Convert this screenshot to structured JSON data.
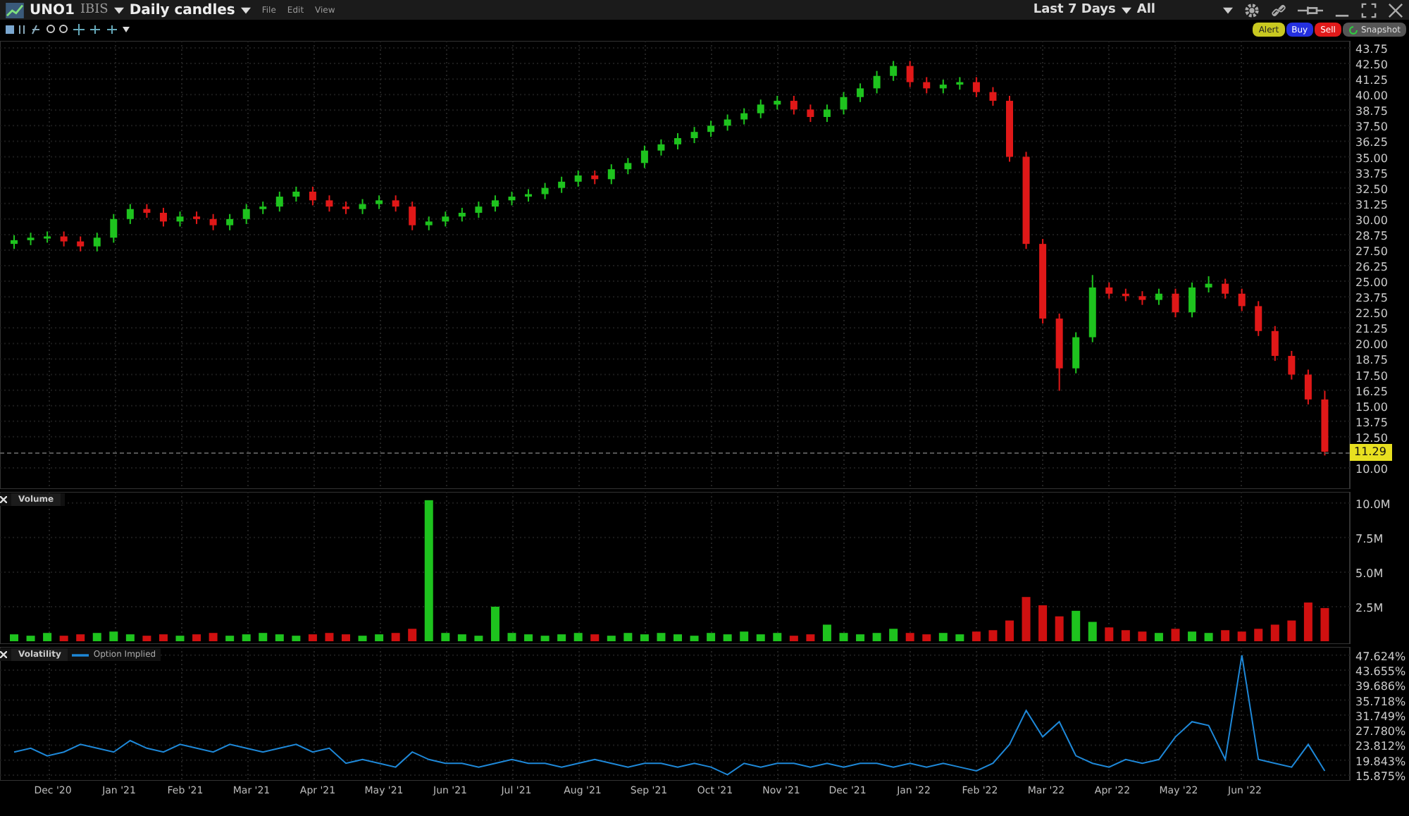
{
  "header": {
    "symbol": "UNO1",
    "exchange": "IBIS",
    "chart_type": "Daily candles",
    "menus": [
      "File",
      "Edit",
      "View"
    ],
    "period": "Last 7 Days",
    "range": "All"
  },
  "order_buttons": [
    {
      "label": "Alert",
      "kind": "alert"
    },
    {
      "label": "Buy",
      "kind": "buy"
    },
    {
      "label": "Sell",
      "kind": "sell"
    },
    {
      "label": "Snapshot",
      "kind": "snapshot"
    }
  ],
  "price_panel": {
    "last_price": "11.29",
    "chart_data": {
      "type": "candlestick",
      "grid": true,
      "categories": [
        null,
        null,
        null,
        null,
        null,
        null,
        null,
        null,
        null,
        null,
        null,
        null,
        null,
        null,
        null,
        null,
        null,
        null,
        null,
        null,
        null,
        null,
        null,
        null,
        null,
        null,
        null,
        null,
        null,
        null,
        null,
        null,
        null,
        null,
        null,
        null,
        null,
        null,
        null,
        null,
        null,
        null,
        null,
        null,
        null,
        null,
        null,
        null,
        null,
        null,
        null,
        null,
        null,
        null,
        null,
        null,
        null,
        null,
        null,
        null,
        null,
        null,
        null,
        null,
        null,
        null,
        null,
        null,
        null,
        null,
        null,
        null,
        null,
        null,
        null,
        null,
        null,
        null,
        null,
        null
      ],
      "ohlc": [
        [
          28.0,
          28.7,
          27.6,
          28.3
        ],
        [
          28.3,
          28.9,
          27.9,
          28.5
        ],
        [
          28.5,
          29.0,
          28.1,
          28.6
        ],
        [
          28.6,
          29.0,
          27.8,
          28.2
        ],
        [
          28.2,
          28.6,
          27.4,
          27.8
        ],
        [
          27.8,
          28.9,
          27.4,
          28.5
        ],
        [
          28.5,
          30.4,
          28.1,
          30.0
        ],
        [
          30.0,
          31.2,
          29.6,
          30.8
        ],
        [
          30.8,
          31.2,
          30.1,
          30.5
        ],
        [
          30.5,
          30.9,
          29.4,
          29.8
        ],
        [
          29.8,
          30.6,
          29.4,
          30.2
        ],
        [
          30.2,
          30.6,
          29.6,
          30.0
        ],
        [
          30.0,
          30.4,
          29.1,
          29.5
        ],
        [
          29.5,
          30.4,
          29.1,
          30.0
        ],
        [
          30.0,
          31.2,
          29.6,
          30.8
        ],
        [
          30.8,
          31.4,
          30.4,
          31.0
        ],
        [
          31.0,
          32.2,
          30.6,
          31.8
        ],
        [
          31.8,
          32.6,
          31.4,
          32.2
        ],
        [
          32.2,
          32.6,
          31.1,
          31.5
        ],
        [
          31.5,
          31.9,
          30.6,
          31.0
        ],
        [
          31.0,
          31.4,
          30.4,
          30.8
        ],
        [
          30.8,
          31.6,
          30.4,
          31.2
        ],
        [
          31.2,
          31.9,
          30.8,
          31.5
        ],
        [
          31.5,
          31.9,
          30.6,
          31.0
        ],
        [
          31.0,
          31.4,
          29.1,
          29.5
        ],
        [
          29.5,
          30.2,
          29.1,
          29.8
        ],
        [
          29.8,
          30.6,
          29.4,
          30.2
        ],
        [
          30.2,
          30.9,
          29.8,
          30.5
        ],
        [
          30.5,
          31.4,
          30.1,
          31.0
        ],
        [
          31.0,
          31.9,
          30.6,
          31.5
        ],
        [
          31.5,
          32.2,
          31.1,
          31.8
        ],
        [
          31.8,
          32.4,
          31.4,
          32.0
        ],
        [
          32.0,
          32.9,
          31.6,
          32.5
        ],
        [
          32.5,
          33.4,
          32.1,
          33.0
        ],
        [
          33.0,
          33.9,
          32.6,
          33.5
        ],
        [
          33.5,
          33.9,
          32.8,
          33.2
        ],
        [
          33.2,
          34.4,
          32.8,
          34.0
        ],
        [
          34.0,
          34.9,
          33.6,
          34.5
        ],
        [
          34.5,
          35.9,
          34.1,
          35.5
        ],
        [
          35.5,
          36.4,
          35.1,
          36.0
        ],
        [
          36.0,
          36.9,
          35.6,
          36.5
        ],
        [
          36.5,
          37.4,
          36.1,
          37.0
        ],
        [
          37.0,
          37.9,
          36.6,
          37.5
        ],
        [
          37.5,
          38.4,
          37.1,
          38.0
        ],
        [
          38.0,
          38.9,
          37.6,
          38.5
        ],
        [
          38.5,
          39.6,
          38.1,
          39.2
        ],
        [
          39.2,
          39.9,
          38.8,
          39.5
        ],
        [
          39.5,
          39.9,
          38.4,
          38.8
        ],
        [
          38.8,
          39.2,
          37.8,
          38.2
        ],
        [
          38.2,
          39.2,
          37.8,
          38.8
        ],
        [
          38.8,
          40.2,
          38.4,
          39.8
        ],
        [
          39.8,
          40.9,
          39.4,
          40.5
        ],
        [
          40.5,
          41.9,
          40.1,
          41.5
        ],
        [
          41.5,
          42.7,
          41.1,
          42.3
        ],
        [
          42.3,
          42.7,
          40.6,
          41.0
        ],
        [
          41.0,
          41.4,
          40.1,
          40.5
        ],
        [
          40.5,
          41.2,
          40.1,
          40.8
        ],
        [
          40.8,
          41.4,
          40.4,
          41.0
        ],
        [
          41.0,
          41.4,
          39.8,
          40.2
        ],
        [
          40.2,
          40.6,
          39.1,
          39.5
        ],
        [
          39.5,
          39.9,
          34.6,
          35.0
        ],
        [
          35.0,
          35.4,
          27.6,
          28.0
        ],
        [
          28.0,
          28.4,
          21.6,
          22.0
        ],
        [
          22.0,
          22.4,
          16.2,
          18.0
        ],
        [
          18.0,
          20.9,
          17.6,
          20.5
        ],
        [
          20.5,
          25.5,
          20.1,
          24.5
        ],
        [
          24.5,
          24.9,
          23.6,
          24.0
        ],
        [
          24.0,
          24.4,
          23.4,
          23.8
        ],
        [
          23.8,
          24.2,
          23.1,
          23.5
        ],
        [
          23.5,
          24.4,
          23.1,
          24.0
        ],
        [
          24.0,
          24.4,
          22.1,
          22.5
        ],
        [
          22.5,
          24.9,
          22.1,
          24.5
        ],
        [
          24.5,
          25.4,
          24.1,
          24.8
        ],
        [
          24.8,
          25.2,
          23.6,
          24.0
        ],
        [
          24.0,
          24.4,
          22.6,
          23.0
        ],
        [
          23.0,
          23.4,
          20.6,
          21.0
        ],
        [
          21.0,
          21.4,
          18.6,
          19.0
        ],
        [
          19.0,
          19.4,
          17.1,
          17.5
        ],
        [
          17.5,
          17.9,
          15.1,
          15.5
        ],
        [
          15.5,
          16.2,
          11.0,
          11.3
        ]
      ],
      "ylim": [
        10,
        43.75
      ],
      "yticks": [
        {
          "value": 43.75,
          "label": "43.75"
        },
        {
          "value": 42.5,
          "label": "42.50"
        },
        {
          "value": 41.25,
          "label": "41.25"
        },
        {
          "value": 40,
          "label": "40.00"
        },
        {
          "value": 38.75,
          "label": "38.75"
        },
        {
          "value": 37.5,
          "label": "37.50"
        },
        {
          "value": 36.25,
          "label": "36.25"
        },
        {
          "value": 35,
          "label": "35.00"
        },
        {
          "value": 33.75,
          "label": "33.75"
        },
        {
          "value": 32.5,
          "label": "32.50"
        },
        {
          "value": 31.25,
          "label": "31.25"
        },
        {
          "value": 30,
          "label": "30.00"
        },
        {
          "value": 28.75,
          "label": "28.75"
        },
        {
          "value": 27.5,
          "label": "27.50"
        },
        {
          "value": 26.25,
          "label": "26.25"
        },
        {
          "value": 25,
          "label": "25.00"
        },
        {
          "value": 23.75,
          "label": "23.75"
        },
        {
          "value": 22.5,
          "label": "22.50"
        },
        {
          "value": 21.25,
          "label": "21.25"
        },
        {
          "value": 20,
          "label": "20.00"
        },
        {
          "value": 18.75,
          "label": "18.75"
        },
        {
          "value": 17.5,
          "label": "17.50"
        },
        {
          "value": 16.25,
          "label": "16.25"
        },
        {
          "value": 15,
          "label": "15.00"
        },
        {
          "value": 13.75,
          "label": "13.75"
        },
        {
          "value": 12.5,
          "label": "12.50"
        },
        {
          "value": 10,
          "label": "10.00"
        }
      ]
    }
  },
  "volume_panel": {
    "title": "Volume",
    "chart_data": {
      "type": "bar",
      "grid": true,
      "stacked": true,
      "categories": [
        null,
        null,
        null,
        null,
        null,
        null,
        null,
        null,
        null,
        null,
        null,
        null,
        null,
        null,
        null,
        null,
        null,
        null,
        null,
        null,
        null,
        null,
        null,
        null,
        null,
        null,
        null,
        null,
        null,
        null,
        null,
        null,
        null,
        null,
        null,
        null,
        null,
        null,
        null,
        null,
        null,
        null,
        null,
        null,
        null,
        null,
        null,
        null,
        null,
        null,
        null,
        null,
        null,
        null,
        null,
        null,
        null,
        null,
        null,
        null,
        null,
        null,
        null,
        null,
        null,
        null,
        null,
        null,
        null,
        null,
        null,
        null,
        null,
        null,
        null,
        null,
        null,
        null,
        null,
        null
      ],
      "series": [
        {
          "color": "#1ec31e",
          "values": [
            0.5,
            0.4,
            0.6,
            null,
            null,
            0.6,
            0.7,
            0.5,
            null,
            null,
            0.4,
            null,
            null,
            0.4,
            0.5,
            0.6,
            0.5,
            0.4,
            null,
            null,
            null,
            0.4,
            0.5,
            null,
            null,
            10.2,
            0.6,
            0.5,
            0.4,
            2.5,
            0.6,
            0.5,
            0.4,
            0.5,
            0.6,
            null,
            0.4,
            0.6,
            0.5,
            0.6,
            0.5,
            0.4,
            0.6,
            0.5,
            0.7,
            0.5,
            0.6,
            null,
            null,
            1.2,
            0.6,
            0.5,
            0.6,
            0.9,
            null,
            null,
            0.6,
            0.5,
            null,
            null,
            null,
            null,
            null,
            null,
            2.2,
            1.4,
            null,
            null,
            null,
            0.6,
            null,
            0.7,
            0.6,
            null,
            null,
            null,
            null,
            null,
            null,
            null
          ]
        },
        {
          "color": "#d01010",
          "values": [
            null,
            null,
            null,
            0.4,
            0.5,
            null,
            null,
            null,
            0.4,
            0.5,
            null,
            0.5,
            0.6,
            null,
            null,
            null,
            null,
            null,
            0.5,
            0.6,
            0.5,
            null,
            null,
            0.6,
            0.9,
            null,
            null,
            null,
            null,
            null,
            null,
            null,
            null,
            null,
            null,
            0.5,
            null,
            null,
            null,
            null,
            null,
            null,
            null,
            null,
            null,
            null,
            null,
            0.4,
            0.5,
            null,
            null,
            null,
            null,
            null,
            0.6,
            0.5,
            null,
            null,
            0.7,
            0.8,
            1.5,
            3.2,
            2.6,
            1.8,
            null,
            null,
            1.0,
            0.8,
            0.7,
            null,
            0.9,
            null,
            null,
            0.8,
            0.7,
            0.9,
            1.2,
            1.5,
            2.8,
            2.4
          ]
        }
      ],
      "ylim": [
        0,
        10.6
      ],
      "yticks": [
        {
          "value": 10,
          "label": "10.0M"
        },
        {
          "value": 7.5,
          "label": "7.5M"
        },
        {
          "value": 5,
          "label": "5.0M"
        },
        {
          "value": 2.5,
          "label": "2.5M"
        }
      ]
    }
  },
  "volatility_panel": {
    "title": "Volatility",
    "chart_data": {
      "type": "line",
      "grid": true,
      "series": [
        {
          "name": "Option Implied",
          "color": "#1e88d8",
          "values": [
            22,
            23,
            21,
            22,
            24,
            23,
            22,
            25,
            23,
            22,
            24,
            23,
            22,
            24,
            23,
            22,
            23,
            24,
            22,
            23,
            19,
            20,
            19,
            18,
            22,
            20,
            19,
            19,
            18,
            19,
            20,
            19,
            19,
            18,
            19,
            20,
            19,
            18,
            19,
            19,
            18,
            19,
            18,
            16,
            19,
            18,
            19,
            19,
            18,
            19,
            18,
            19,
            19,
            18,
            19,
            18,
            19,
            18,
            17,
            19,
            24,
            33,
            26,
            30,
            21,
            19,
            18,
            20,
            19,
            20,
            26,
            30,
            29,
            20,
            47.6,
            20,
            19,
            18,
            24,
            17
          ]
        }
      ],
      "ylim": [
        15.875,
        49.8
      ],
      "yticks": [
        {
          "value": 47.624,
          "label": "47.624%"
        },
        {
          "value": 43.655,
          "label": "43.655%"
        },
        {
          "value": 39.686,
          "label": "39.686%"
        },
        {
          "value": 35.718,
          "label": "35.718%"
        },
        {
          "value": 31.749,
          "label": "31.749%"
        },
        {
          "value": 27.78,
          "label": "27.780%"
        },
        {
          "value": 23.812,
          "label": "23.812%"
        },
        {
          "value": 19.843,
          "label": "19.843%"
        },
        {
          "value": 15.875,
          "label": "15.875%"
        }
      ]
    }
  },
  "time_axis": [
    "Dec '20",
    "Jan '21",
    "Feb '21",
    "Mar '21",
    "Apr '21",
    "May '21",
    "Jun '21",
    "Jul '21",
    "Aug '21",
    "Sep '21",
    "Oct '21",
    "Nov '21",
    "Dec '21",
    "Jan '22",
    "Feb '22",
    "Mar '22",
    "Apr '22",
    "May '22",
    "Jun '22"
  ]
}
